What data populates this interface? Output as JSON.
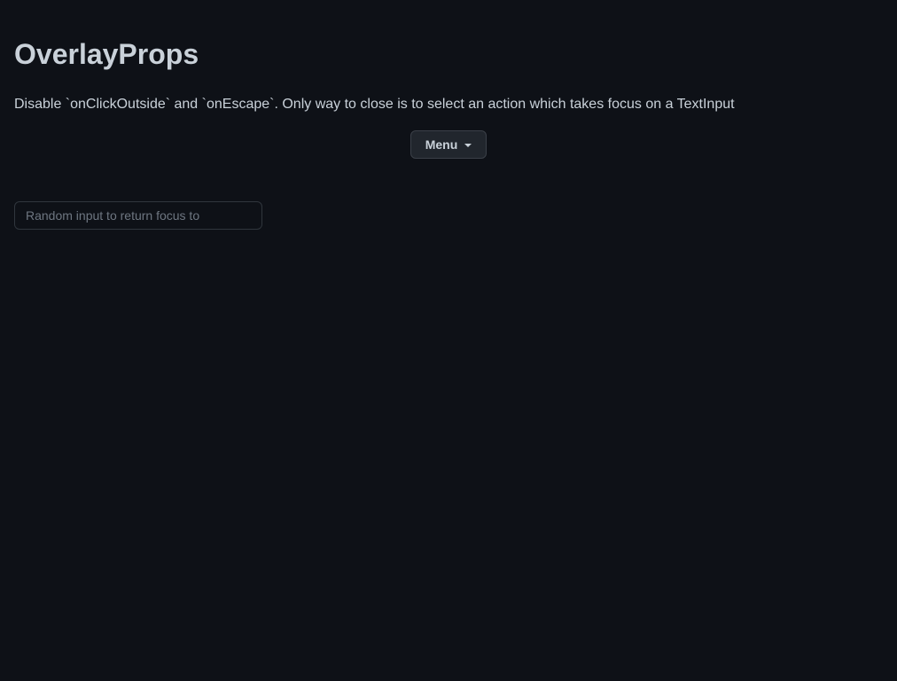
{
  "page": {
    "title": "OverlayProps",
    "description": "Disable `onClickOutside` and `onEscape`. Only way to close is to select an action which takes focus on a TextInput"
  },
  "menu_button": {
    "label": "Menu",
    "icon": "triangle-down-icon"
  },
  "text_input": {
    "value": "",
    "placeholder": "Random input to return focus to"
  },
  "colors": {
    "background": "#0e1117",
    "text": "#c9d1d9",
    "button_background": "#21262d",
    "button_border": "#3b4048",
    "input_border": "#30363d",
    "placeholder": "#6e7681"
  }
}
